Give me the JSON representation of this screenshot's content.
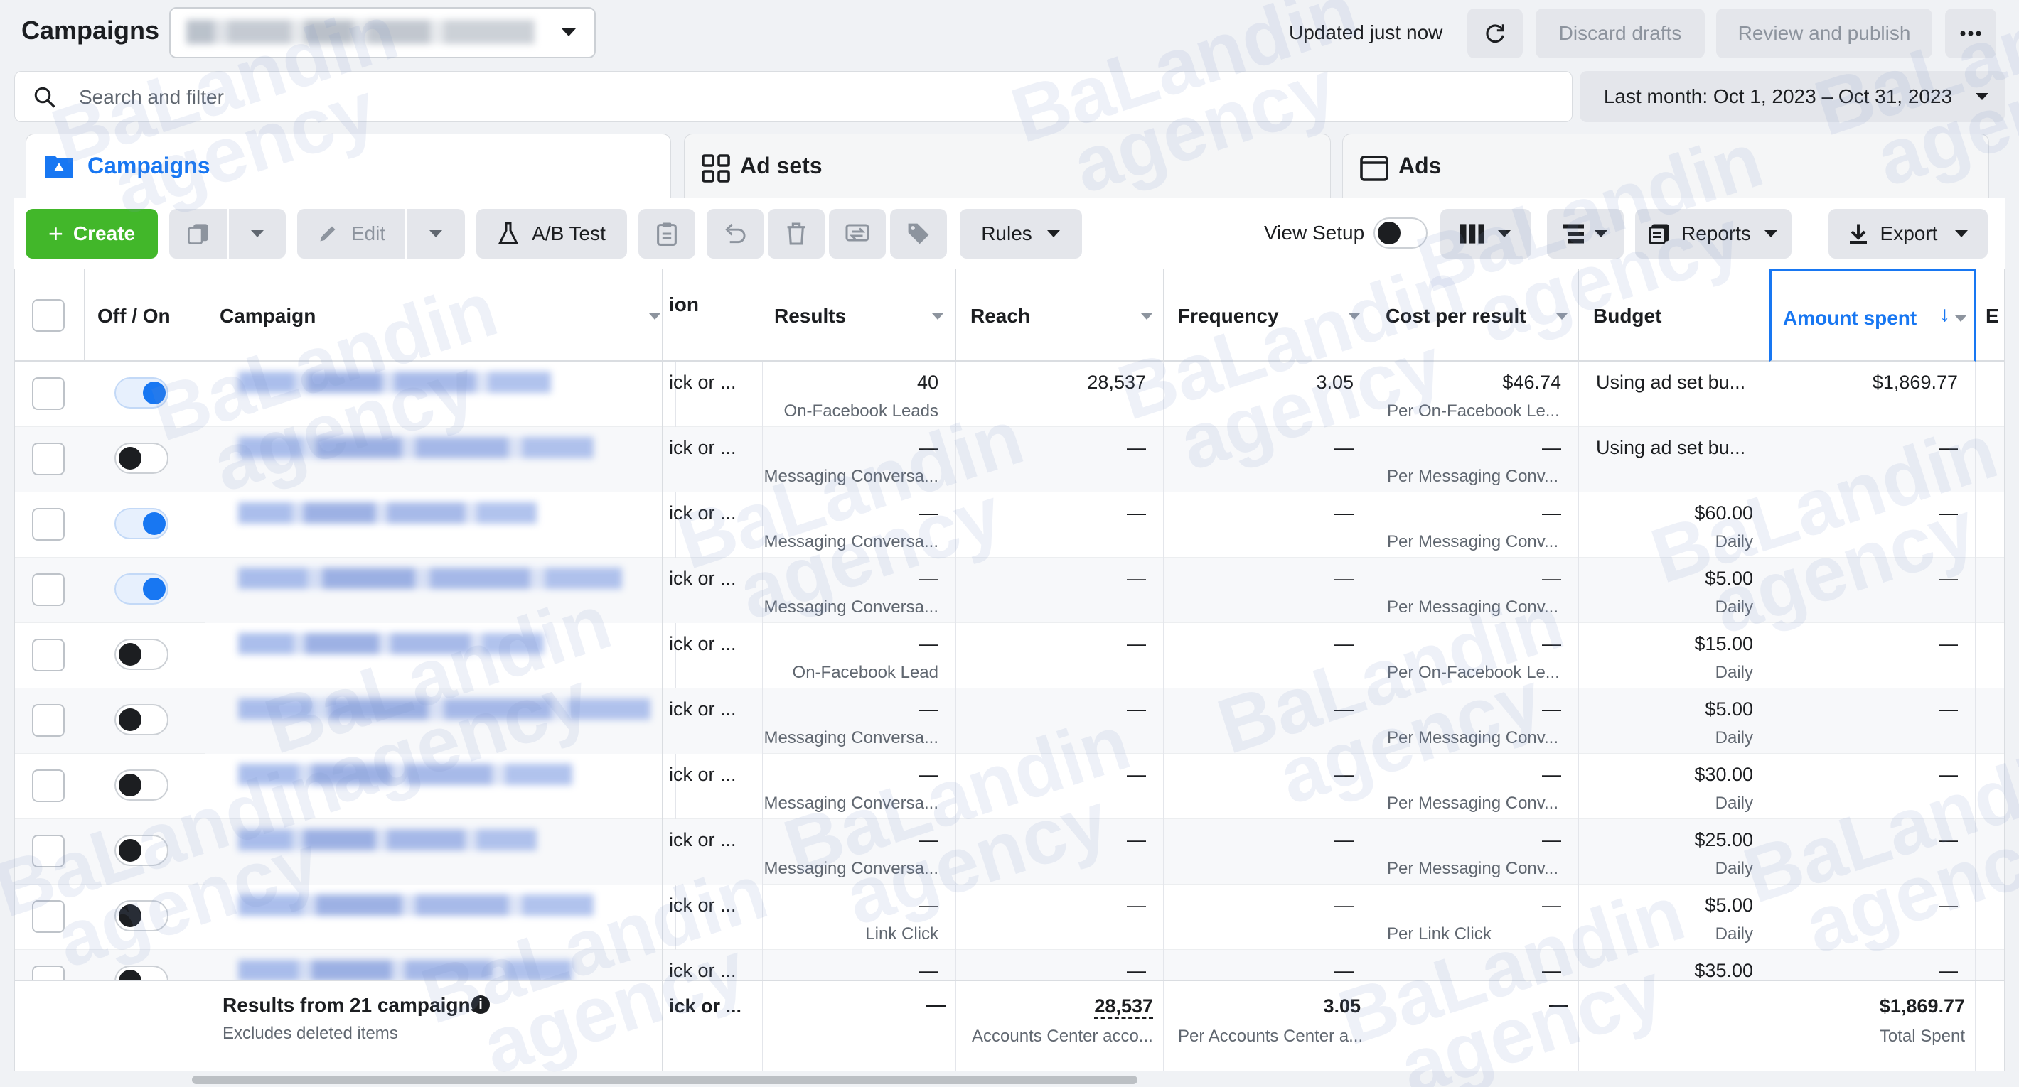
{
  "header": {
    "title": "Campaigns",
    "updated": "Updated just now",
    "discard": "Discard drafts",
    "review": "Review and publish"
  },
  "search": {
    "placeholder": "Search and filter"
  },
  "date_range": "Last month: Oct 1, 2023 – Oct 31, 2023",
  "tabs": [
    {
      "label": "Campaigns"
    },
    {
      "label": "Ad sets"
    },
    {
      "label": "Ads"
    }
  ],
  "toolbar": {
    "create": "Create",
    "edit": "Edit",
    "ab_test": "A/B Test",
    "rules": "Rules",
    "view_setup": "View Setup",
    "reports": "Reports",
    "export": "Export"
  },
  "columns": {
    "off_on": "Off / On",
    "campaign": "Campaign",
    "attribution": "ion",
    "results": "Results",
    "reach": "Reach",
    "frequency": "Frequency",
    "cost": "Cost per result",
    "budget": "Budget",
    "amount": "Amount spent",
    "next": "E"
  },
  "rows": [
    {
      "attr": "ick or ...",
      "results": "40",
      "results_sub": "On-Facebook Leads",
      "reach": "28,537",
      "freq": "3.05",
      "cost": "$46.74",
      "cost_sub": "Per On-Facebook Le...",
      "budget": "Using ad set bu...",
      "budget_sub": "",
      "amount": "$1,869.77"
    },
    {
      "attr": "ick or ...",
      "results": "—",
      "results_sub": "Messaging Conversa...",
      "reach": "—",
      "freq": "—",
      "cost": "—",
      "cost_sub": "Per Messaging Conv...",
      "budget": "Using ad set bu...",
      "budget_sub": "",
      "amount": "—"
    },
    {
      "attr": "ick or ...",
      "results": "—",
      "results_sub": "Messaging Conversa...",
      "reach": "—",
      "freq": "—",
      "cost": "—",
      "cost_sub": "Per Messaging Conv...",
      "budget": "$60.00",
      "budget_sub": "Daily",
      "amount": "—"
    },
    {
      "attr": "ick or ...",
      "results": "—",
      "results_sub": "Messaging Conversa...",
      "reach": "—",
      "freq": "—",
      "cost": "—",
      "cost_sub": "Per Messaging Conv...",
      "budget": "$5.00",
      "budget_sub": "Daily",
      "amount": "—"
    },
    {
      "attr": "ick or ...",
      "results": "—",
      "results_sub": "On-Facebook Lead",
      "reach": "—",
      "freq": "—",
      "cost": "—",
      "cost_sub": "Per On-Facebook Le...",
      "budget": "$15.00",
      "budget_sub": "Daily",
      "amount": "—"
    },
    {
      "attr": "ick or ...",
      "results": "—",
      "results_sub": "Messaging Conversa...",
      "reach": "—",
      "freq": "—",
      "cost": "—",
      "cost_sub": "Per Messaging Conv...",
      "budget": "$5.00",
      "budget_sub": "Daily",
      "amount": "—"
    },
    {
      "attr": "ick or ...",
      "results": "—",
      "results_sub": "Messaging Conversa...",
      "reach": "—",
      "freq": "—",
      "cost": "—",
      "cost_sub": "Per Messaging Conv...",
      "budget": "$30.00",
      "budget_sub": "Daily",
      "amount": "—"
    },
    {
      "attr": "ick or ...",
      "results": "—",
      "results_sub": "Messaging Conversa...",
      "reach": "—",
      "freq": "—",
      "cost": "—",
      "cost_sub": "Per Messaging Conv...",
      "budget": "$25.00",
      "budget_sub": "Daily",
      "amount": "—"
    },
    {
      "attr": "ick or ...",
      "results": "—",
      "results_sub": "Link Click",
      "reach": "—",
      "freq": "—",
      "cost": "—",
      "cost_sub": "Per Link Click",
      "budget": "$5.00",
      "budget_sub": "Daily",
      "amount": "—"
    },
    {
      "attr": "ick or ...",
      "results": "—",
      "results_sub": "",
      "reach": "—",
      "freq": "—",
      "cost": "—",
      "cost_sub": "",
      "budget": "$35.00",
      "budget_sub": "",
      "amount": "—"
    }
  ],
  "footer": {
    "title": "Results from 21 campaigns",
    "sub": "Excludes deleted items",
    "attr": "ick or ...",
    "results": "—",
    "reach": "28,537",
    "reach_sub": "Accounts Center acco...",
    "freq": "3.05",
    "freq_sub": "Per Accounts Center a...",
    "cost": "—",
    "amount": "$1,869.77",
    "amount_sub": "Total Spent"
  },
  "watermark": {
    "line1": "BaLandin",
    "line2": "agency"
  },
  "colors": {
    "accent": "#1877f2",
    "create": "#42b72a"
  }
}
